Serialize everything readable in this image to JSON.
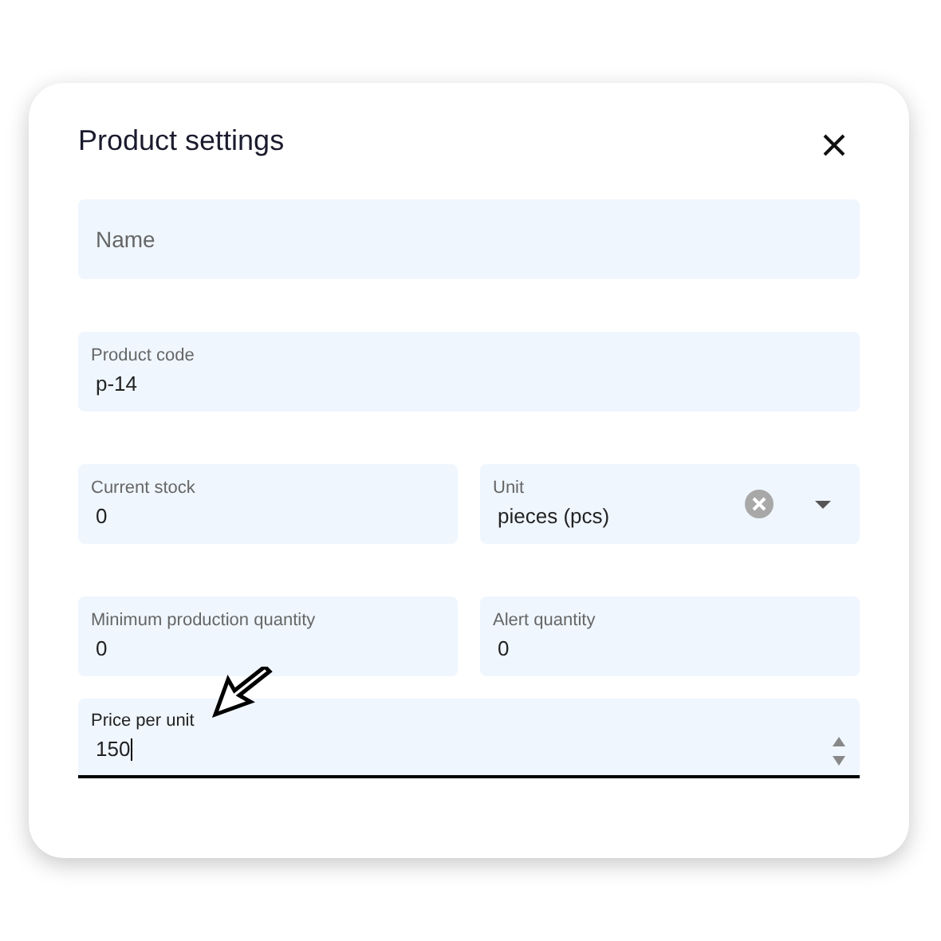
{
  "dialog": {
    "title": "Product settings"
  },
  "rows": [
    [
      {
        "kind": "text",
        "placeholder": "Name",
        "focused": false
      }
    ],
    [
      {
        "kind": "text",
        "label": "Product code",
        "value": "p-14",
        "focused": false
      }
    ],
    [
      {
        "kind": "text",
        "label": "Current stock",
        "value": "0",
        "focused": false
      },
      {
        "kind": "select",
        "label": "Unit",
        "value": "pieces (pcs)",
        "focused": false
      }
    ],
    [
      {
        "kind": "text",
        "label": "Minimum production quantity",
        "value": "0",
        "focused": false
      },
      {
        "kind": "text",
        "label": "Alert quantity",
        "value": "0",
        "focused": false
      }
    ],
    [
      {
        "kind": "number",
        "label": "Price per unit",
        "value": "150",
        "focused": true
      }
    ]
  ]
}
